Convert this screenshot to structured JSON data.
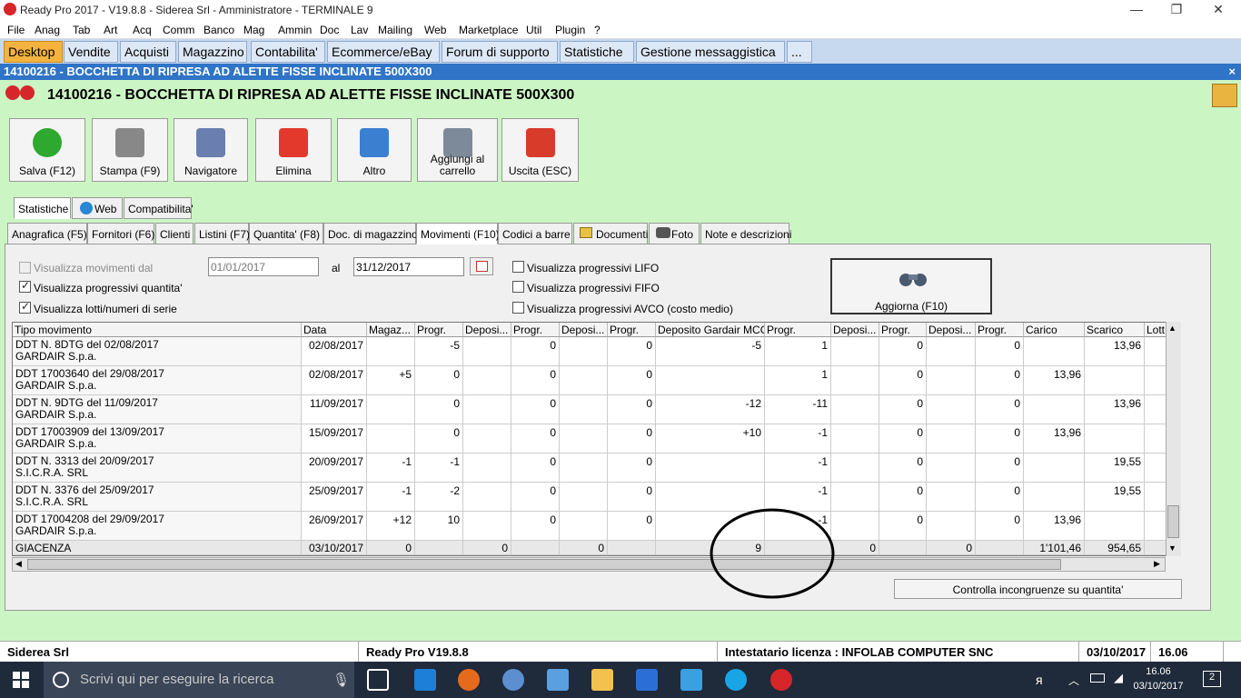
{
  "window": {
    "title": "Ready Pro 2017 - V19.8.8 - Siderea Srl - Amministratore - TERMINALE 9"
  },
  "menu": [
    "File",
    "Anag",
    "Tab",
    "Art",
    "Acq",
    "Comm",
    "Banco",
    "Mag",
    "Ammin",
    "Doc",
    "Lav",
    "Mailing",
    "Web",
    "Marketplace",
    "Util",
    "Plugin",
    "?"
  ],
  "module_tabs": [
    "Desktop",
    "Vendite",
    "Acquisti",
    "Magazzino",
    "Contabilita'",
    "Ecommerce/eBay",
    "Forum di supporto",
    "Statistiche",
    "Gestione messaggistica",
    "..."
  ],
  "doc_strip": {
    "title": "14100216 - BOCCHETTA DI RIPRESA AD ALETTE FISSE INCLINATE 500X300",
    "close": "×"
  },
  "header": {
    "title": "14100216 - BOCCHETTA DI RIPRESA AD ALETTE FISSE INCLINATE 500X300"
  },
  "toolbar": [
    {
      "label": "Salva (F12)",
      "icon": "check-icon",
      "color": "#2ea82e"
    },
    {
      "label": "Stampa (F9)",
      "icon": "printer-icon",
      "color": "#888888"
    },
    {
      "label": "Navigatore",
      "icon": "compass-icon",
      "color": "#6a7fb0"
    },
    {
      "label": "Elimina",
      "icon": "delete-x-icon",
      "color": "#e2392c"
    },
    {
      "label": "Altro",
      "icon": "magnifier-icon",
      "color": "#3a7fd0"
    },
    {
      "label": "Aggiungi al carrello",
      "icon": "cart-icon",
      "color": "#7c8a99"
    },
    {
      "label": "Uscita (ESC)",
      "icon": "exit-icon",
      "color": "#d93b2b"
    }
  ],
  "top_tabs": [
    "Statistiche",
    "Web",
    "Compatibilita'"
  ],
  "tabs": [
    "Anagrafica (F5)",
    "Fornitori (F6)",
    "Clienti",
    "Listini (F7)",
    "Quantita' (F8)",
    "Doc. di magazzino",
    "Movimenti (F10)",
    "Codici a barre",
    "Documenti",
    "Foto",
    "Note e descrizioni"
  ],
  "filters": {
    "show_moves_from": "Visualizza movimenti dal",
    "date_from": "01/01/2017",
    "al": "al",
    "date_to": "31/12/2017",
    "progressivi_quantita": "Visualizza progressivi quantita'",
    "lotti": "Visualizza lotti/numeri di serie",
    "lifo": "Visualizza progressivi LIFO",
    "fifo": "Visualizza progressivi FIFO",
    "avco": "Visualizza progressivi AVCO (costo medio)",
    "refresh": "Aggiorna (F10)"
  },
  "grid": {
    "columns": [
      "Tipo movimento",
      "Data",
      "Magaz...",
      "Progr.",
      "Deposi...",
      "Progr.",
      "Deposi...",
      "Progr.",
      "Deposito Gardair MCG",
      "Progr.",
      "Deposi...",
      "Progr.",
      "Deposi...",
      "Progr.",
      "Carico",
      "Scarico",
      "Lott"
    ],
    "rows": [
      {
        "tipo1": "DDT N. 8DTG del 02/08/2017",
        "tipo2": "GARDAIR S.p.a.",
        "data": "02/08/2017",
        "v": [
          "",
          "-5",
          "",
          "0",
          "",
          "0",
          "-5",
          "1",
          "",
          "0",
          "",
          "0",
          "",
          "13,96"
        ]
      },
      {
        "tipo1": "DDT 17003640 del 29/08/2017",
        "tipo2": "GARDAIR S.p.a.",
        "data": "02/08/2017",
        "v": [
          "+5",
          "0",
          "",
          "0",
          "",
          "0",
          "",
          "1",
          "",
          "0",
          "",
          "0",
          "13,96",
          ""
        ]
      },
      {
        "tipo1": "DDT N. 9DTG del 11/09/2017",
        "tipo2": "GARDAIR S.p.a.",
        "data": "11/09/2017",
        "v": [
          "",
          "0",
          "",
          "0",
          "",
          "0",
          "-12",
          "-11",
          "",
          "0",
          "",
          "0",
          "",
          "13,96"
        ]
      },
      {
        "tipo1": "DDT 17003909 del 13/09/2017",
        "tipo2": "GARDAIR S.p.a.",
        "data": "15/09/2017",
        "v": [
          "",
          "0",
          "",
          "0",
          "",
          "0",
          "+10",
          "-1",
          "",
          "0",
          "",
          "0",
          "13,96",
          ""
        ]
      },
      {
        "tipo1": "DDT N. 3313 del 20/09/2017",
        "tipo2": "S.I.C.R.A. SRL",
        "data": "20/09/2017",
        "v": [
          "-1",
          "-1",
          "",
          "0",
          "",
          "0",
          "",
          "-1",
          "",
          "0",
          "",
          "0",
          "",
          "19,55"
        ]
      },
      {
        "tipo1": "DDT N. 3376 del 25/09/2017",
        "tipo2": "S.I.C.R.A. SRL",
        "data": "25/09/2017",
        "v": [
          "-1",
          "-2",
          "",
          "0",
          "",
          "0",
          "",
          "-1",
          "",
          "0",
          "",
          "0",
          "",
          "19,55"
        ]
      },
      {
        "tipo1": "DDT 17004208 del 29/09/2017",
        "tipo2": "GARDAIR S.p.a.",
        "data": "26/09/2017",
        "v": [
          "+12",
          "10",
          "",
          "0",
          "",
          "0",
          "",
          "-1",
          "",
          "0",
          "",
          "0",
          "13,96",
          ""
        ]
      }
    ],
    "giacenza": {
      "label": "GIACENZA",
      "data": "03/10/2017",
      "v": [
        "0",
        "",
        "0",
        "",
        "0",
        "",
        "9",
        "",
        "0",
        "",
        "0",
        "",
        "1'101,46",
        "954,65"
      ]
    }
  },
  "check_button": "Controlla incongruenze su quantita'",
  "status": {
    "company": "Siderea Srl",
    "version": "Ready Pro V19.8.8",
    "license": "Intestatario licenza : INFOLAB COMPUTER SNC",
    "date": "03/10/2017",
    "time": "16.06"
  },
  "taskbar": {
    "search_placeholder": "Scrivi qui per eseguire la ricerca",
    "clock_time": "16.06",
    "clock_date": "03/10/2017",
    "notifications": "2"
  }
}
